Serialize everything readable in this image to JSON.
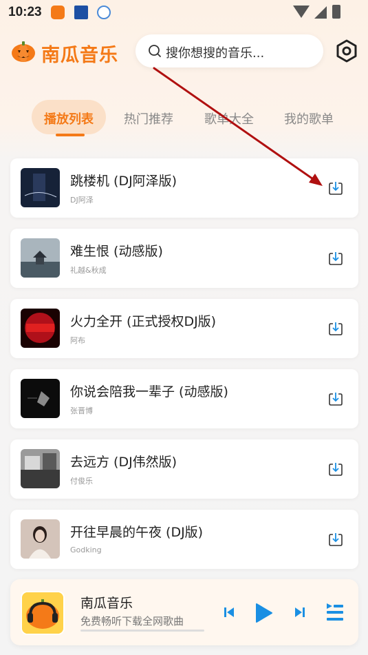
{
  "status_bar": {
    "time": "10:23"
  },
  "header": {
    "app_title": "南瓜音乐",
    "search_placeholder": "搜你想搜的音乐..."
  },
  "tabs": [
    {
      "label": "播放列表",
      "active": true
    },
    {
      "label": "热门推荐",
      "active": false
    },
    {
      "label": "歌单大全",
      "active": false
    },
    {
      "label": "我的歌单",
      "active": false
    }
  ],
  "songs": [
    {
      "title": "跳楼机 (DJ阿泽版)",
      "artist": "DJ阿泽",
      "cover_color": "#1a2740"
    },
    {
      "title": "难生恨 (动感版)",
      "artist": "礼越&秋成",
      "cover_color": "#7a8c98"
    },
    {
      "title": "火力全开 (正式授权DJ版)",
      "artist": "阿布",
      "cover_color": "#b0101a"
    },
    {
      "title": "你说会陪我一辈子 (动感版)",
      "artist": "张晋博",
      "cover_color": "#111111"
    },
    {
      "title": "去远方 (DJ伟然版)",
      "artist": "付俊乐",
      "cover_color": "#6a6a6a"
    },
    {
      "title": "开往早晨的午夜 (DJ版)",
      "artist": "Godking",
      "cover_color": "#c9b8ae"
    }
  ],
  "player": {
    "title": "南瓜音乐",
    "subtitle": "免费畅听下载全网歌曲",
    "progress": 0
  },
  "colors": {
    "accent": "#f47a18",
    "control_blue": "#1a8fe3",
    "annotation_arrow": "#b01010"
  }
}
